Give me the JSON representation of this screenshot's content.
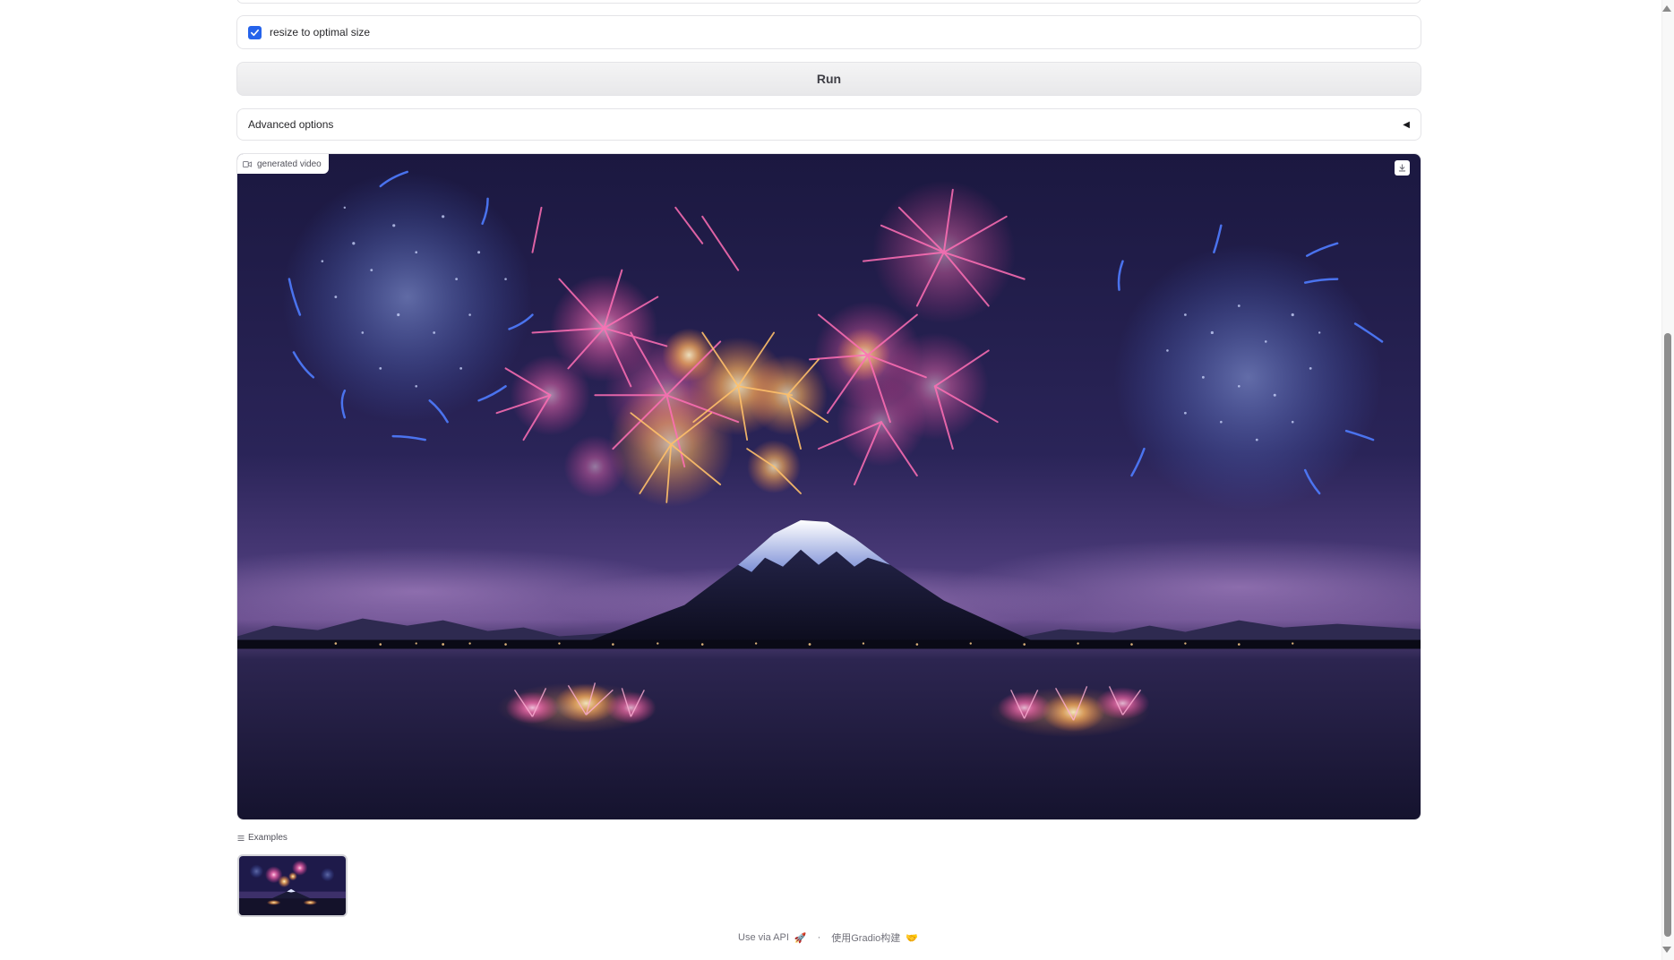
{
  "options": {
    "resize_checkbox": {
      "label": "resize to optimal size",
      "checked": true
    }
  },
  "run_button": {
    "label": "Run"
  },
  "advanced_options": {
    "label": "Advanced options",
    "caret": "◀"
  },
  "video_output": {
    "label": "generated video",
    "icon": "video-icon",
    "download_icon": "download-icon"
  },
  "examples": {
    "label": "Examples",
    "icon": "list-icon",
    "items": [
      {
        "thumbnail": "fireworks-over-mount-fuji"
      }
    ]
  },
  "footer": {
    "api_link": "Use via API",
    "api_emoji": "🚀",
    "separator": "·",
    "built_with": "使用Gradio构建",
    "built_emoji": "🤝"
  },
  "colors": {
    "accent": "#2563eb",
    "night_sky": "#1e1a4a",
    "firework_pink": "#ff5fb0",
    "firework_gold": "#ffc06a",
    "firework_blue": "#4f7cff"
  }
}
